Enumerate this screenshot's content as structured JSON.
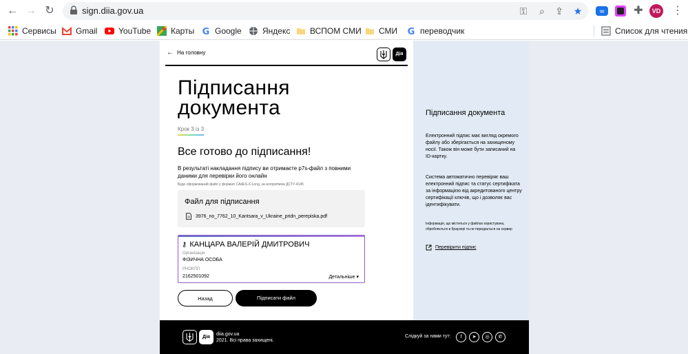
{
  "browser": {
    "url": "sign.diia.gov.ua",
    "avatar_initials": "VD",
    "bookmarks": [
      {
        "label": "Сервисы",
        "icon": "apps-grid-icon"
      },
      {
        "label": "Gmail",
        "icon": "gmail-icon"
      },
      {
        "label": "YouTube",
        "icon": "youtube-icon"
      },
      {
        "label": "Карты",
        "icon": "maps-icon"
      },
      {
        "label": "Google",
        "icon": "google-icon"
      },
      {
        "label": "Яндекс",
        "icon": "globe-icon"
      },
      {
        "label": "ВСПОМ СМИ",
        "icon": "folder-icon"
      },
      {
        "label": "СМИ",
        "icon": "folder-icon"
      },
      {
        "label": "переводчик",
        "icon": "google-icon"
      }
    ],
    "reading_list": "Список для чтения"
  },
  "header": {
    "back_label": "На головну",
    "diia_logo": "Дія"
  },
  "main": {
    "title_line1": "Підписання",
    "title_line2": "документа",
    "step": "Крок 3 із 3",
    "ready_heading": "Все готово до підписання!",
    "description": "В результаті накладання підпису ви отримаєте p7s-файл з повними даними для перевірки його онлайн",
    "format_note": "Буде сформований файл у форматі CAdES-X-Long, за алгоритмом ДСТУ-4145",
    "file_box": {
      "title": "Файл для підписання",
      "filename": "3976_no_7762_10_Kantsara_v_Ukraine_pridn_perepiska.pdf"
    },
    "signer": {
      "name": "КАНЦАРА ВАЛЕРІЙ ДМИТРОВИЧ",
      "org_label": "Організація",
      "org_value": "ФІЗИЧНА ОСОБА",
      "rnokpp_label": "РНОКПП",
      "rnokpp_value": "2162501092",
      "details_label": "Детальніше"
    },
    "back_button": "Назад",
    "sign_button": "Підписати файл"
  },
  "sidebar": {
    "title": "Підписання документа",
    "p1": "Електронний підпис має вигляд окремого файлу або зберігається на захищеному носії. Також він може бути записаний на ID-картку.",
    "p2": "Система автоматично перевіряє ваш електронний підпис та статус сертифіката за інформацією від акредитованого центру сертифікації ключів, що і дозволяє вас ідентифікувати.",
    "note": "Інформація, що міститься у файлах користувача, обробляється в браузері та не передається на сервер",
    "verify_link": "Перевірити підпис"
  },
  "footer": {
    "diia_logo": "Дія",
    "site": "diia.gov.ua",
    "copyright": "2021. Всі права захищені.",
    "follow": "Слідкуй за нами тут:",
    "social": [
      "facebook-icon",
      "telegram-icon",
      "instagram-icon",
      "viber-icon"
    ]
  },
  "colors": {
    "sidebar_bg": "#e2ebf5",
    "footer_bg": "#000000",
    "accent_border": "#8a5ec8"
  }
}
